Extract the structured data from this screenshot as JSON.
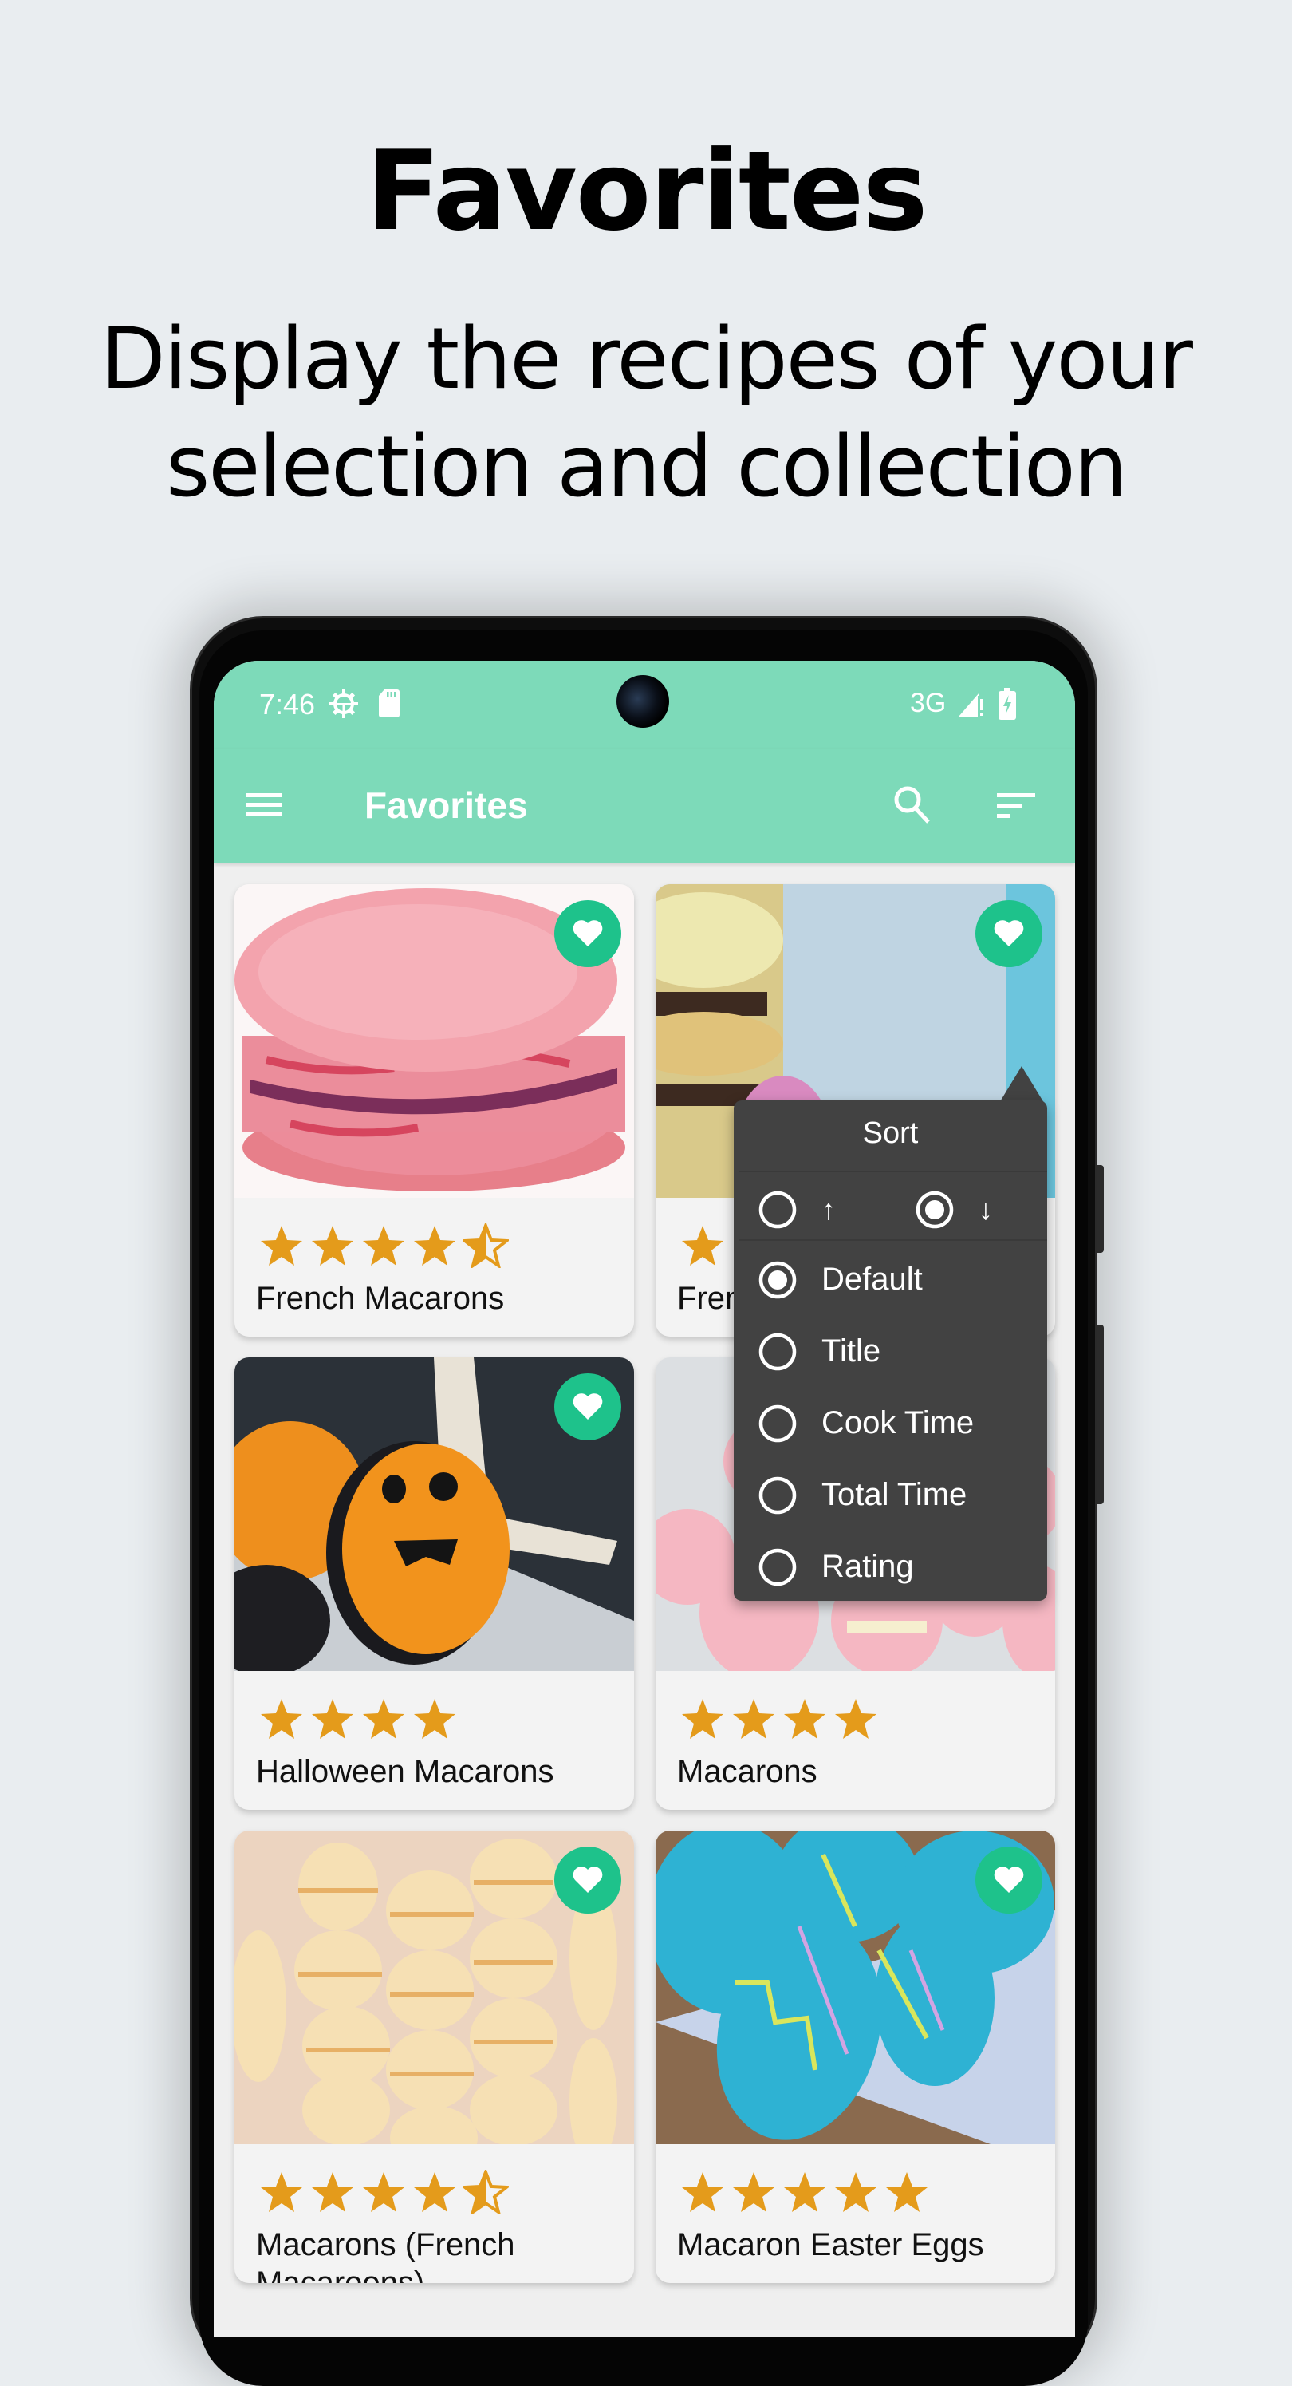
{
  "promo": {
    "headline": "Favorites",
    "subtitle_line1": "Display the recipes of your",
    "subtitle_line2": "selection and collection"
  },
  "status_bar": {
    "time": "7:46",
    "left_icons": [
      "settings-gear-icon",
      "sd-card-icon"
    ],
    "network": "3G",
    "right_icons": [
      "signal-alert-icon",
      "battery-charging-icon"
    ]
  },
  "app_bar": {
    "title": "Favorites",
    "left_icon": "menu-icon",
    "actions": [
      "search-icon",
      "sort-icon"
    ]
  },
  "colors": {
    "primary": "#7ddab9",
    "favorite_badge": "#1ec28b",
    "star": "#e49b1b",
    "popup_bg": "#424242",
    "page_bg": "#e9edf0"
  },
  "sort_menu": {
    "title": "Sort",
    "direction": {
      "ascending_label": "↑",
      "descending_label": "↓",
      "selected": "descending"
    },
    "options": [
      {
        "label": "Default",
        "selected": true
      },
      {
        "label": "Title",
        "selected": false
      },
      {
        "label": "Cook Time",
        "selected": false
      },
      {
        "label": "Total Time",
        "selected": false
      },
      {
        "label": "Rating",
        "selected": false
      }
    ]
  },
  "recipes": [
    {
      "title": "French Macarons",
      "rating": 4.5,
      "favorite": true,
      "image": "pink-macaron"
    },
    {
      "title": "Fren",
      "rating": 1,
      "favorite": true,
      "image": "yellow-macarons",
      "partially_hidden": true
    },
    {
      "title": "Halloween Macarons",
      "rating": 4,
      "favorite": true,
      "image": "halloween-macarons"
    },
    {
      "title": "Macarons",
      "rating": 4,
      "favorite": true,
      "image": "pink-macarons-group"
    },
    {
      "title": "Macarons (French Macaroons)",
      "rating": 4.5,
      "favorite": true,
      "image": "vanilla-macarons"
    },
    {
      "title": "Macaron Easter Eggs",
      "rating": 5,
      "favorite": true,
      "image": "blue-easter-macarons"
    }
  ]
}
